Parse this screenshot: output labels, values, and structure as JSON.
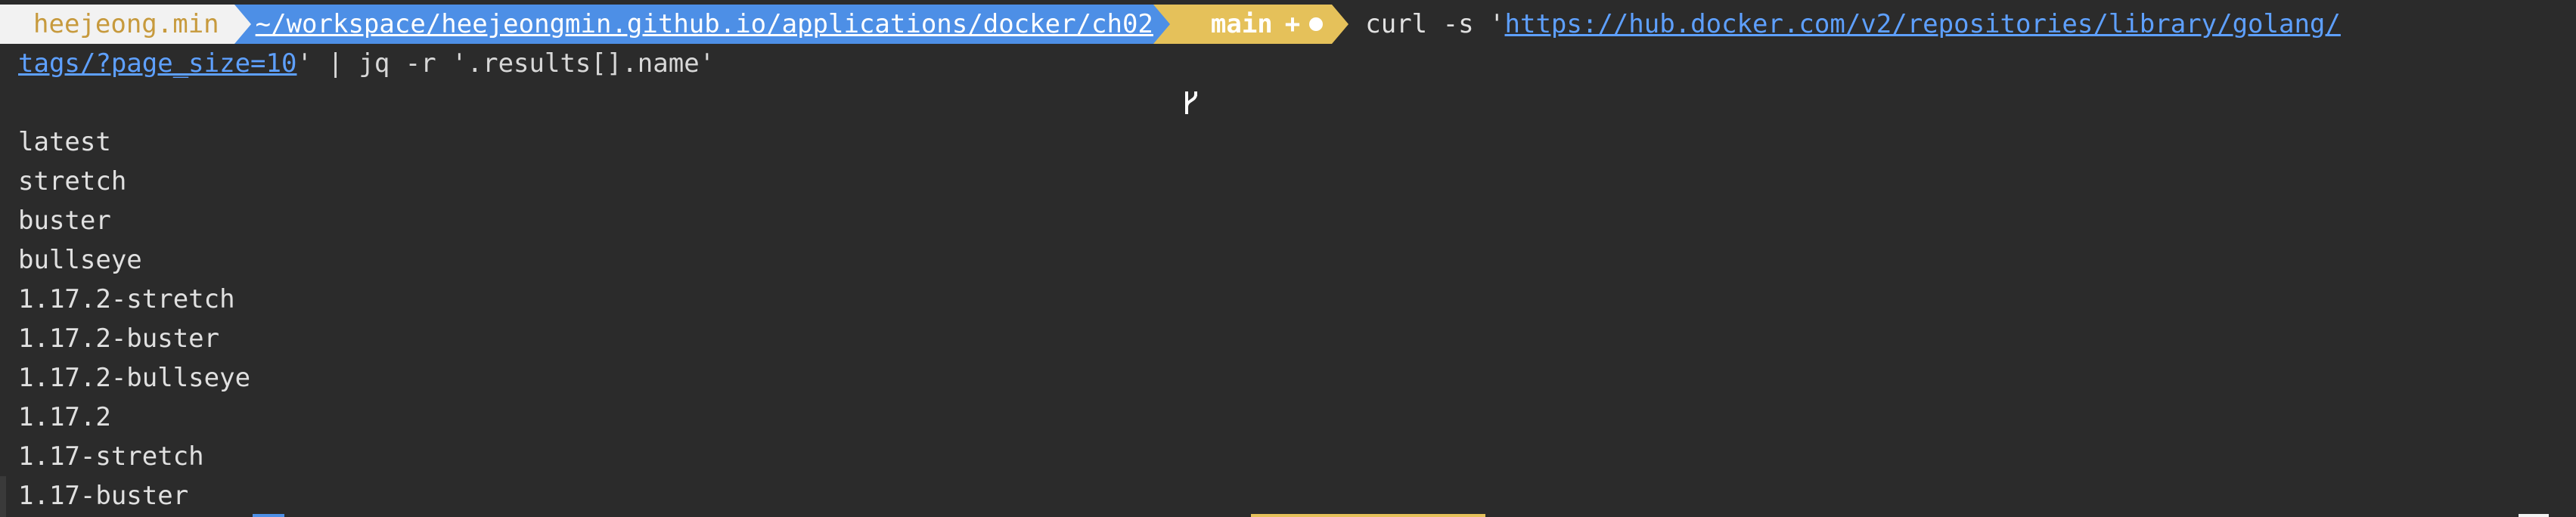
{
  "prompt": {
    "user": "heejeong.min",
    "path": "~/workspace/heejeongmin.github.io/applications/docker/ch02",
    "branch_icon": "git-branch-icon",
    "branch": "main",
    "plus": "+",
    "dirty_icon": "dirty-dot-icon"
  },
  "command": {
    "prefix": "curl -s '",
    "url_part1": "https://hub.docker.com/v2/repositories/library/golang/",
    "url_part2": "tags/?page_size=10",
    "suffix": "' | jq -r '.results[].name'"
  },
  "output": [
    "latest",
    "stretch",
    "buster",
    "bullseye",
    "1.17.2-stretch",
    "1.17.2-buster",
    "1.17.2-bullseye",
    "1.17.2",
    "1.17-stretch",
    "1.17-buster"
  ],
  "colors": {
    "background": "#2b2b2b",
    "user_segment": "#f2f2f2",
    "path_segment": "#4d8fe6",
    "git_segment": "#e5c15a",
    "link": "#5ea0ff"
  }
}
